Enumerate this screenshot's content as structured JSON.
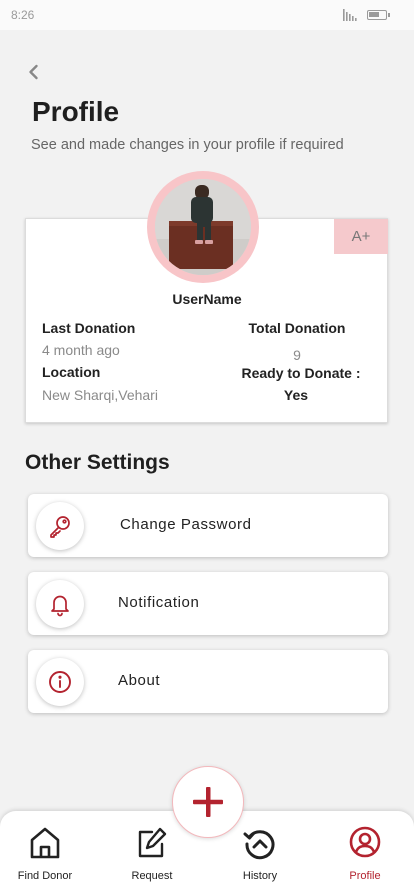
{
  "status_bar": {
    "time": "8:26"
  },
  "header": {
    "title": "Profile",
    "subtitle": "See and made changes in your profile if required"
  },
  "profile": {
    "blood_group": "A+",
    "username": "UserName",
    "last_donation_label": "Last Donation",
    "last_donation_value": "4 month ago",
    "location_label": "Location",
    "location_value": "New Sharqi,Vehari",
    "total_donation_label": "Total Donation",
    "total_donation_value": "9",
    "ready_label": "Ready to Donate :",
    "ready_value": "Yes"
  },
  "settings": {
    "title": "Other Settings",
    "items": [
      {
        "label": "Change Password",
        "icon": "key-icon"
      },
      {
        "label": "Notification",
        "icon": "bell-icon"
      },
      {
        "label": "About",
        "icon": "info-icon"
      }
    ]
  },
  "bottom_nav": {
    "items": [
      {
        "label": "Find Donor",
        "icon": "home-icon"
      },
      {
        "label": "Request",
        "icon": "edit-icon"
      },
      {
        "label": "History",
        "icon": "history-icon"
      },
      {
        "label": "Profile",
        "icon": "user-circle-icon",
        "active": true
      }
    ],
    "fab_icon": "plus-icon"
  },
  "colors": {
    "accent": "#b3232f",
    "badge_bg": "#f5c9cc",
    "ring": "#f8c5c8",
    "background": "#f2f2f2"
  }
}
